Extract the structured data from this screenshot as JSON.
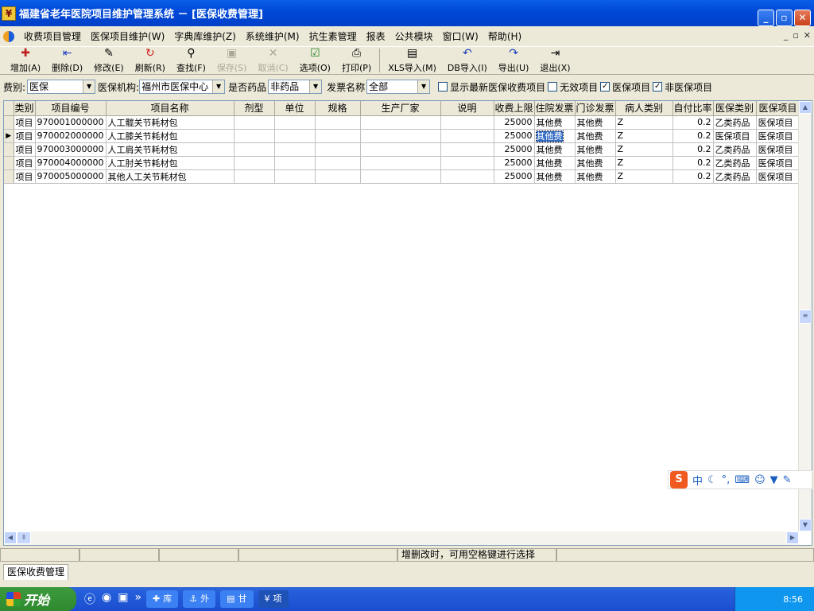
{
  "window": {
    "title": "福建省老年医院项目维护管理系统 － [医保收费管理]",
    "min": "_",
    "max": "▫",
    "close": "✕"
  },
  "menu": [
    "收费项目管理",
    "医保项目维护(W)",
    "字典库维护(Z)",
    "系统维护(M)",
    "抗生素管理",
    "报表",
    "公共模块",
    "窗口(W)",
    "帮助(H)"
  ],
  "mdi_buttons": [
    "_",
    "▫",
    "✕"
  ],
  "toolbar": [
    {
      "label": "增加(A)",
      "icon": "add-icon",
      "enabled": true
    },
    {
      "label": "删除(D)",
      "icon": "delete-icon",
      "enabled": true
    },
    {
      "label": "修改(E)",
      "icon": "edit-icon",
      "enabled": true
    },
    {
      "label": "刷新(R)",
      "icon": "refresh-icon",
      "enabled": true
    },
    {
      "label": "查找(F)",
      "icon": "find-icon",
      "enabled": true
    },
    {
      "label": "保存(S)",
      "icon": "save-icon",
      "enabled": false
    },
    {
      "label": "取消(C)",
      "icon": "cancel-icon",
      "enabled": false
    },
    {
      "label": "选项(O)",
      "icon": "options-icon",
      "enabled": true
    },
    {
      "label": "打印(P)",
      "icon": "print-icon",
      "enabled": true
    },
    {
      "label": "XLS导入(M)",
      "icon": "xls-import-icon",
      "enabled": true
    },
    {
      "label": "DB导入(I)",
      "icon": "db-import-icon",
      "enabled": true
    },
    {
      "label": "导出(U)",
      "icon": "export-icon",
      "enabled": true
    },
    {
      "label": "退出(X)",
      "icon": "exit-icon",
      "enabled": true
    }
  ],
  "filter": {
    "fee_type_label": "费别:",
    "fee_type_value": "医保",
    "org_label": "医保机构:",
    "org_value": "福州市医保中心",
    "is_drug_label": "是否药品",
    "is_drug_value": "非药品",
    "invoice_label": "发票名称",
    "invoice_value": "全部",
    "cb1_label": "显示最新医保收费项目",
    "cb1_checked": false,
    "cb2_label": "无效项目",
    "cb2_checked": true,
    "cb3_label": "医保项目",
    "cb3_checked": true,
    "cb4_label": "非医保项目"
  },
  "grid": {
    "columns": [
      "类别",
      "项目编号",
      "项目名称",
      "剂型",
      "单位",
      "规格",
      "生产厂家",
      "说明",
      "收费上限",
      "住院发票",
      "门诊发票",
      "病人类别",
      "自付比率",
      "医保类别",
      "医保项目"
    ],
    "rows": [
      [
        "项目",
        "970001000000",
        "人工髋关节耗材包",
        "",
        "",
        "",
        "",
        "",
        "25000",
        "其他费",
        "其他费",
        "Z",
        "0.2",
        "乙类药品",
        "医保项目"
      ],
      [
        "项目",
        "970002000000",
        "人工膝关节耗材包",
        "",
        "",
        "",
        "",
        "",
        "25000",
        "其他费",
        "其他费",
        "Z",
        "0.2",
        "医保项目",
        "医保项目"
      ],
      [
        "项目",
        "970003000000",
        "人工肩关节耗材包",
        "",
        "",
        "",
        "",
        "",
        "25000",
        "其他费",
        "其他费",
        "Z",
        "0.2",
        "乙类药品",
        "医保项目"
      ],
      [
        "项目",
        "970004000000",
        "人工肘关节耗材包",
        "",
        "",
        "",
        "",
        "",
        "25000",
        "其他费",
        "其他费",
        "Z",
        "0.2",
        "乙类药品",
        "医保项目"
      ],
      [
        "项目",
        "970005000000",
        "其他人工关节耗材包",
        "",
        "",
        "",
        "",
        "",
        "25000",
        "其他费",
        "其他费",
        "Z",
        "0.2",
        "乙类药品",
        "医保项目"
      ]
    ],
    "current_row": 1
  },
  "status": {
    "hint": "增删改时，可用空格键进行选择"
  },
  "tab": {
    "label": "医保收费管理"
  },
  "taskbar": {
    "start": "开始",
    "tasks": [
      "库",
      "外",
      "甘",
      "项"
    ],
    "clock": "8:56"
  },
  "ime": {
    "mode": "中"
  }
}
